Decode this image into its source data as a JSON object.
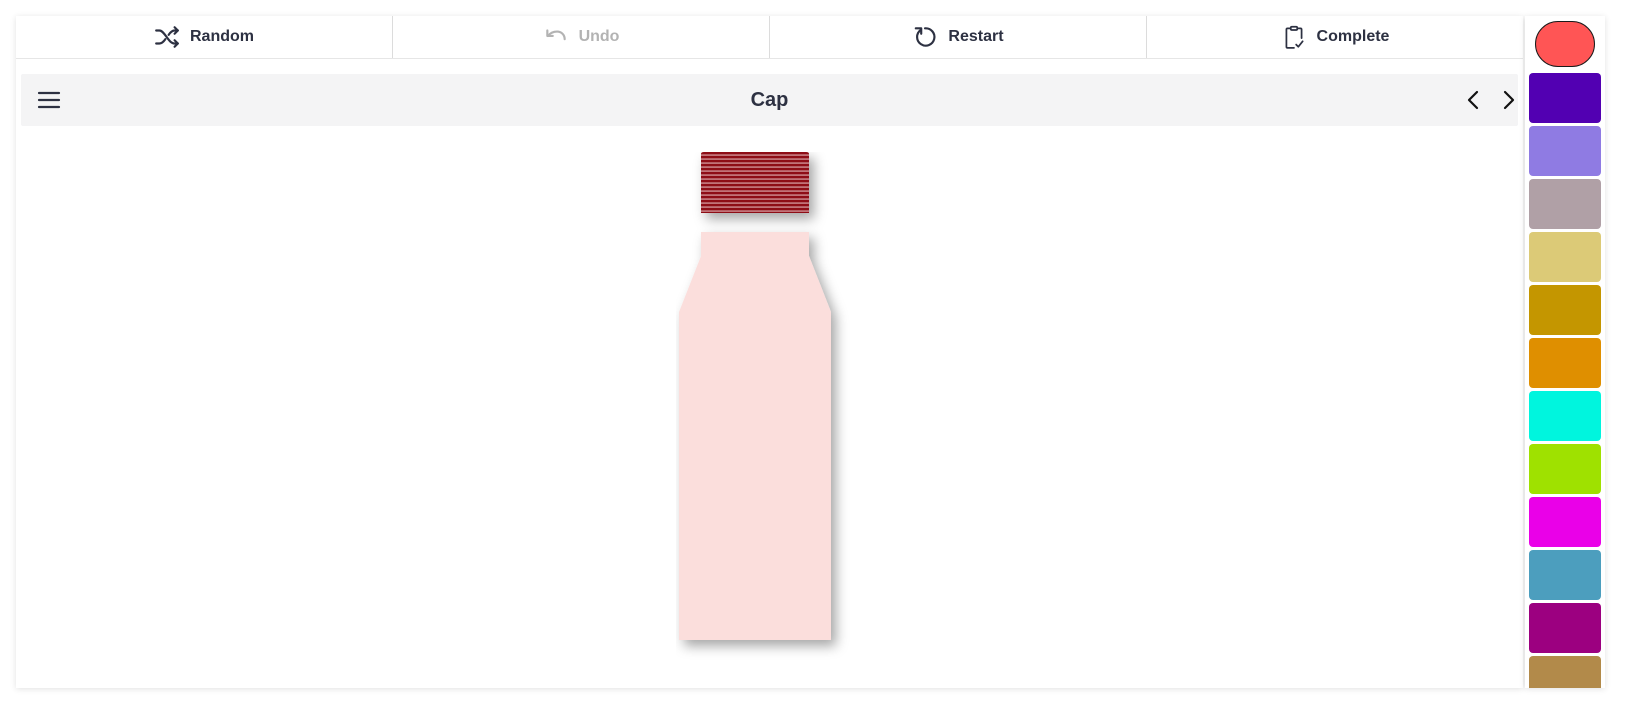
{
  "toolbar": {
    "random_label": "Random",
    "undo_label": "Undo",
    "restart_label": "Restart",
    "complete_label": "Complete"
  },
  "header": {
    "title": "Cap"
  },
  "bottle": {
    "body_color": "#fbdedc",
    "cap_color": "#8e0a12",
    "cap_stripe_color": "#f4d9d9"
  },
  "palette": {
    "selected_color": "#ff5555",
    "colors": [
      "#5200b2",
      "#8f7be3",
      "#b0a0a6",
      "#dcca77",
      "#c49600",
      "#df8f00",
      "#00f5de",
      "#9fe100",
      "#ea00e8",
      "#4c9ebe",
      "#9c0080",
      "#b28a4a"
    ]
  }
}
